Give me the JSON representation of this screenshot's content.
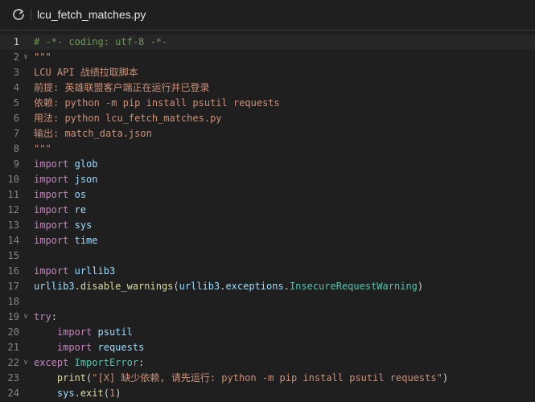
{
  "header": {
    "refresh_icon": "refresh-icon",
    "filename": "lcu_fetch_matches.py"
  },
  "editor": {
    "active_line": 1,
    "lines": [
      {
        "n": "1",
        "fold": false,
        "tokens": [
          {
            "t": "cmt",
            "v": "# -*- coding: utf-8 -*-"
          }
        ]
      },
      {
        "n": "2",
        "fold": true,
        "tokens": [
          {
            "t": "str",
            "v": "\"\"\""
          }
        ]
      },
      {
        "n": "3",
        "fold": false,
        "tokens": [
          {
            "t": "str",
            "v": "LCU API 战绩拉取脚本"
          }
        ]
      },
      {
        "n": "4",
        "fold": false,
        "tokens": [
          {
            "t": "str",
            "v": "前提: 英雄联盟客户端正在运行并已登录"
          }
        ]
      },
      {
        "n": "5",
        "fold": false,
        "tokens": [
          {
            "t": "str",
            "v": "依赖: python -m pip install psutil requests"
          }
        ]
      },
      {
        "n": "6",
        "fold": false,
        "tokens": [
          {
            "t": "str",
            "v": "用法: python lcu_fetch_matches.py"
          }
        ]
      },
      {
        "n": "7",
        "fold": false,
        "tokens": [
          {
            "t": "str",
            "v": "输出: match_data.json"
          }
        ]
      },
      {
        "n": "8",
        "fold": false,
        "tokens": [
          {
            "t": "str",
            "v": "\"\"\""
          }
        ]
      },
      {
        "n": "9",
        "fold": false,
        "tokens": [
          {
            "t": "kw",
            "v": "import"
          },
          {
            "t": "pl",
            "v": " "
          },
          {
            "t": "mod",
            "v": "glob"
          }
        ]
      },
      {
        "n": "10",
        "fold": false,
        "tokens": [
          {
            "t": "kw",
            "v": "import"
          },
          {
            "t": "pl",
            "v": " "
          },
          {
            "t": "mod",
            "v": "json"
          }
        ]
      },
      {
        "n": "11",
        "fold": false,
        "tokens": [
          {
            "t": "kw",
            "v": "import"
          },
          {
            "t": "pl",
            "v": " "
          },
          {
            "t": "mod",
            "v": "os"
          }
        ]
      },
      {
        "n": "12",
        "fold": false,
        "tokens": [
          {
            "t": "kw",
            "v": "import"
          },
          {
            "t": "pl",
            "v": " "
          },
          {
            "t": "mod",
            "v": "re"
          }
        ]
      },
      {
        "n": "13",
        "fold": false,
        "tokens": [
          {
            "t": "kw",
            "v": "import"
          },
          {
            "t": "pl",
            "v": " "
          },
          {
            "t": "mod",
            "v": "sys"
          }
        ]
      },
      {
        "n": "14",
        "fold": false,
        "tokens": [
          {
            "t": "kw",
            "v": "import"
          },
          {
            "t": "pl",
            "v": " "
          },
          {
            "t": "mod",
            "v": "time"
          }
        ]
      },
      {
        "n": "15",
        "fold": false,
        "tokens": []
      },
      {
        "n": "16",
        "fold": false,
        "tokens": [
          {
            "t": "kw",
            "v": "import"
          },
          {
            "t": "pl",
            "v": " "
          },
          {
            "t": "mod",
            "v": "urllib3"
          }
        ]
      },
      {
        "n": "17",
        "fold": false,
        "tokens": [
          {
            "t": "mod",
            "v": "urllib3"
          },
          {
            "t": "pl",
            "v": "."
          },
          {
            "t": "fn",
            "v": "disable_warnings"
          },
          {
            "t": "pl",
            "v": "("
          },
          {
            "t": "mod",
            "v": "urllib3"
          },
          {
            "t": "pl",
            "v": "."
          },
          {
            "t": "mod",
            "v": "exceptions"
          },
          {
            "t": "pl",
            "v": "."
          },
          {
            "t": "cls",
            "v": "InsecureRequestWarning"
          },
          {
            "t": "pl",
            "v": ")"
          }
        ]
      },
      {
        "n": "18",
        "fold": false,
        "tokens": []
      },
      {
        "n": "19",
        "fold": true,
        "tokens": [
          {
            "t": "kw",
            "v": "try"
          },
          {
            "t": "pl",
            "v": ":"
          }
        ]
      },
      {
        "n": "20",
        "fold": false,
        "tokens": [
          {
            "t": "pl",
            "v": "    "
          },
          {
            "t": "kw",
            "v": "import"
          },
          {
            "t": "pl",
            "v": " "
          },
          {
            "t": "mod",
            "v": "psutil"
          }
        ]
      },
      {
        "n": "21",
        "fold": false,
        "tokens": [
          {
            "t": "pl",
            "v": "    "
          },
          {
            "t": "kw",
            "v": "import"
          },
          {
            "t": "pl",
            "v": " "
          },
          {
            "t": "mod",
            "v": "requests"
          }
        ]
      },
      {
        "n": "22",
        "fold": true,
        "tokens": [
          {
            "t": "kw",
            "v": "except"
          },
          {
            "t": "pl",
            "v": " "
          },
          {
            "t": "cls",
            "v": "ImportError"
          },
          {
            "t": "pl",
            "v": ":"
          }
        ]
      },
      {
        "n": "23",
        "fold": false,
        "tokens": [
          {
            "t": "pl",
            "v": "    "
          },
          {
            "t": "fn",
            "v": "print"
          },
          {
            "t": "pl",
            "v": "("
          },
          {
            "t": "str",
            "v": "\"[X] 缺少依赖, 请先运行: python -m pip install psutil requests\""
          },
          {
            "t": "pl",
            "v": ")"
          }
        ]
      },
      {
        "n": "24",
        "fold": false,
        "tokens": [
          {
            "t": "pl",
            "v": "    "
          },
          {
            "t": "mod",
            "v": "sys"
          },
          {
            "t": "pl",
            "v": "."
          },
          {
            "t": "fn",
            "v": "exit"
          },
          {
            "t": "pl",
            "v": "("
          },
          {
            "t": "str",
            "v": "1"
          },
          {
            "t": "pl",
            "v": ")"
          }
        ]
      }
    ]
  }
}
